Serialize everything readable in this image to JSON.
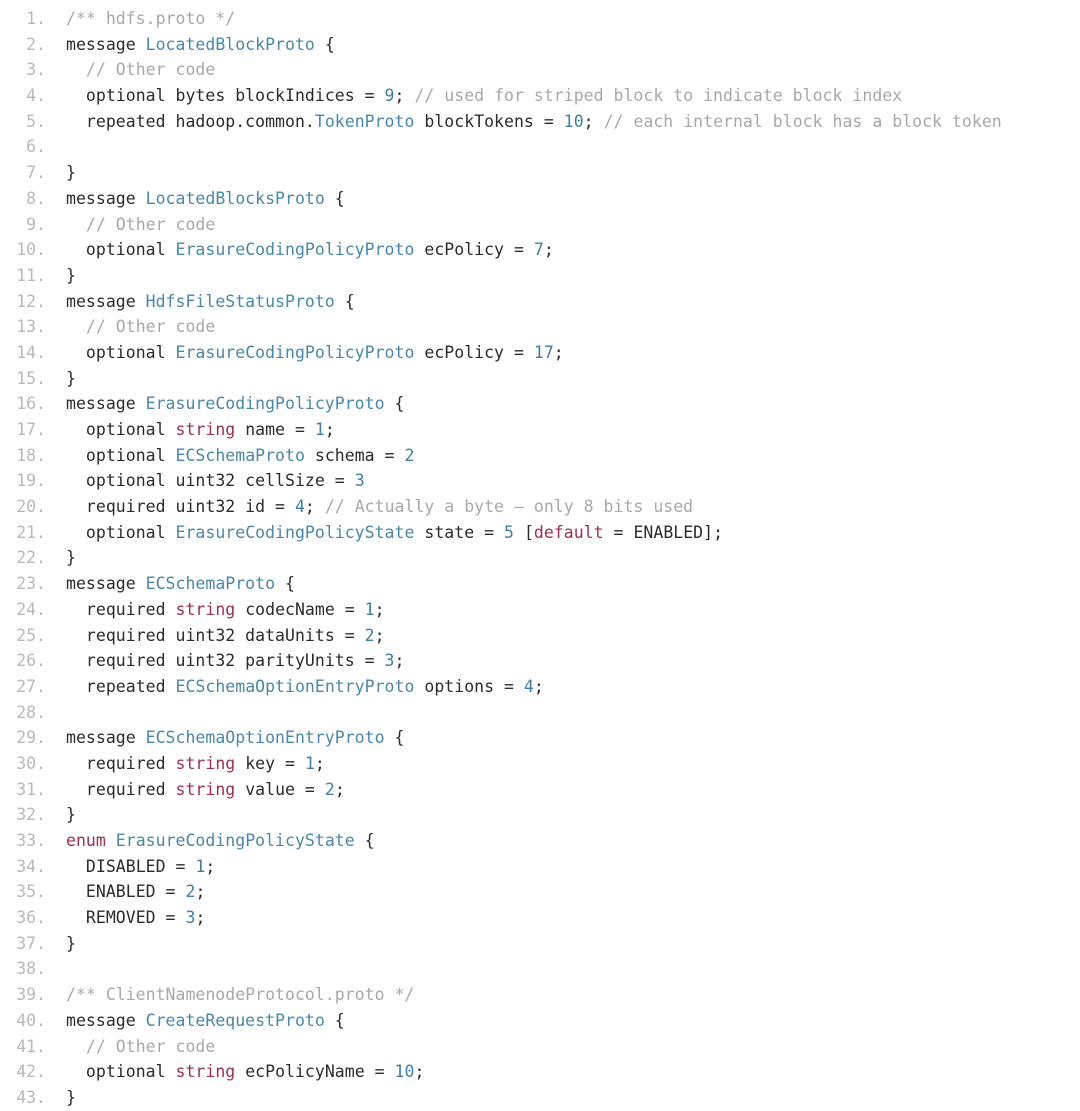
{
  "editor": {
    "title": "hdfs.proto code listing",
    "language": "protobuf",
    "background_color": "#ffffff",
    "colors": {
      "line_number": "#b9b9b9",
      "plain_text": "#2b2b2b",
      "type_name": "#4a87a8",
      "number_literal": "#3f7fa5",
      "keyword": "#9c2f55",
      "comment": "#a8a8a8"
    },
    "first_line_number": 1,
    "last_line_number": 43,
    "total_lines": 43
  },
  "lines": [
    {
      "n": "1.",
      "tokens": [
        {
          "t": "comment",
          "v": "/** hdfs.proto */"
        }
      ],
      "indent": 0
    },
    {
      "n": "2.",
      "tokens": [
        {
          "t": "plain",
          "v": "message "
        },
        {
          "t": "type",
          "v": "LocatedBlockProto"
        },
        {
          "t": "plain",
          "v": " {"
        }
      ],
      "indent": 0
    },
    {
      "n": "3.",
      "tokens": [
        {
          "t": "comment",
          "v": "// Other code"
        }
      ],
      "indent": 1
    },
    {
      "n": "4.",
      "tokens": [
        {
          "t": "plain",
          "v": "optional bytes blockIndices = "
        },
        {
          "t": "number",
          "v": "9"
        },
        {
          "t": "plain",
          "v": "; "
        },
        {
          "t": "comment",
          "v": "// used for striped block to indicate block index"
        }
      ],
      "indent": 1
    },
    {
      "n": "5.",
      "tokens": [
        {
          "t": "plain",
          "v": "repeated hadoop.common."
        },
        {
          "t": "type",
          "v": "TokenProto"
        },
        {
          "t": "plain",
          "v": " blockTokens = "
        },
        {
          "t": "number",
          "v": "10"
        },
        {
          "t": "plain",
          "v": "; "
        },
        {
          "t": "comment",
          "v": "// each internal block has a block token"
        }
      ],
      "indent": 1
    },
    {
      "n": "6.",
      "tokens": [],
      "indent": 0
    },
    {
      "n": "7.",
      "tokens": [
        {
          "t": "plain",
          "v": "}"
        }
      ],
      "indent": 0
    },
    {
      "n": "8.",
      "tokens": [
        {
          "t": "plain",
          "v": "message "
        },
        {
          "t": "type",
          "v": "LocatedBlocksProto"
        },
        {
          "t": "plain",
          "v": " {"
        }
      ],
      "indent": 0
    },
    {
      "n": "9.",
      "tokens": [
        {
          "t": "comment",
          "v": "// Other code"
        }
      ],
      "indent": 1
    },
    {
      "n": "10.",
      "tokens": [
        {
          "t": "plain",
          "v": "optional "
        },
        {
          "t": "type",
          "v": "ErasureCodingPolicyProto"
        },
        {
          "t": "plain",
          "v": " ecPolicy = "
        },
        {
          "t": "number",
          "v": "7"
        },
        {
          "t": "plain",
          "v": ";"
        }
      ],
      "indent": 1
    },
    {
      "n": "11.",
      "tokens": [
        {
          "t": "plain",
          "v": "}"
        }
      ],
      "indent": 0
    },
    {
      "n": "12.",
      "tokens": [
        {
          "t": "plain",
          "v": "message "
        },
        {
          "t": "type",
          "v": "HdfsFileStatusProto"
        },
        {
          "t": "plain",
          "v": " {"
        }
      ],
      "indent": 0
    },
    {
      "n": "13.",
      "tokens": [
        {
          "t": "comment",
          "v": "// Other code"
        }
      ],
      "indent": 1
    },
    {
      "n": "14.",
      "tokens": [
        {
          "t": "plain",
          "v": "optional "
        },
        {
          "t": "type",
          "v": "ErasureCodingPolicyProto"
        },
        {
          "t": "plain",
          "v": " ecPolicy = "
        },
        {
          "t": "number",
          "v": "17"
        },
        {
          "t": "plain",
          "v": ";"
        }
      ],
      "indent": 1
    },
    {
      "n": "15.",
      "tokens": [
        {
          "t": "plain",
          "v": "}"
        }
      ],
      "indent": 0
    },
    {
      "n": "16.",
      "tokens": [
        {
          "t": "plain",
          "v": "message "
        },
        {
          "t": "type",
          "v": "ErasureCodingPolicyProto"
        },
        {
          "t": "plain",
          "v": " {"
        }
      ],
      "indent": 0
    },
    {
      "n": "17.",
      "tokens": [
        {
          "t": "plain",
          "v": "optional "
        },
        {
          "t": "keyword",
          "v": "string"
        },
        {
          "t": "plain",
          "v": " name = "
        },
        {
          "t": "number",
          "v": "1"
        },
        {
          "t": "plain",
          "v": ";"
        }
      ],
      "indent": 1
    },
    {
      "n": "18.",
      "tokens": [
        {
          "t": "plain",
          "v": "optional "
        },
        {
          "t": "type",
          "v": "ECSchemaProto"
        },
        {
          "t": "plain",
          "v": " schema = "
        },
        {
          "t": "number",
          "v": "2"
        }
      ],
      "indent": 1
    },
    {
      "n": "19.",
      "tokens": [
        {
          "t": "plain",
          "v": "optional uint32 cellSize = "
        },
        {
          "t": "number",
          "v": "3"
        }
      ],
      "indent": 1
    },
    {
      "n": "20.",
      "tokens": [
        {
          "t": "plain",
          "v": "required uint32 id = "
        },
        {
          "t": "number",
          "v": "4"
        },
        {
          "t": "plain",
          "v": "; "
        },
        {
          "t": "comment",
          "v": "// Actually a byte – only 8 bits used"
        }
      ],
      "indent": 1
    },
    {
      "n": "21.",
      "tokens": [
        {
          "t": "plain",
          "v": "optional "
        },
        {
          "t": "type",
          "v": "ErasureCodingPolicyState"
        },
        {
          "t": "plain",
          "v": " state = "
        },
        {
          "t": "number",
          "v": "5"
        },
        {
          "t": "plain",
          "v": " ["
        },
        {
          "t": "keyword",
          "v": "default"
        },
        {
          "t": "plain",
          "v": " = ENABLED];"
        }
      ],
      "indent": 1
    },
    {
      "n": "22.",
      "tokens": [
        {
          "t": "plain",
          "v": "}"
        }
      ],
      "indent": 0
    },
    {
      "n": "23.",
      "tokens": [
        {
          "t": "plain",
          "v": "message "
        },
        {
          "t": "type",
          "v": "ECSchemaProto"
        },
        {
          "t": "plain",
          "v": " {"
        }
      ],
      "indent": 0
    },
    {
      "n": "24.",
      "tokens": [
        {
          "t": "plain",
          "v": "required "
        },
        {
          "t": "keyword",
          "v": "string"
        },
        {
          "t": "plain",
          "v": " codecName = "
        },
        {
          "t": "number",
          "v": "1"
        },
        {
          "t": "plain",
          "v": ";"
        }
      ],
      "indent": 1
    },
    {
      "n": "25.",
      "tokens": [
        {
          "t": "plain",
          "v": "required uint32 dataUnits = "
        },
        {
          "t": "number",
          "v": "2"
        },
        {
          "t": "plain",
          "v": ";"
        }
      ],
      "indent": 1
    },
    {
      "n": "26.",
      "tokens": [
        {
          "t": "plain",
          "v": "required uint32 parityUnits = "
        },
        {
          "t": "number",
          "v": "3"
        },
        {
          "t": "plain",
          "v": ";"
        }
      ],
      "indent": 1
    },
    {
      "n": "27.",
      "tokens": [
        {
          "t": "plain",
          "v": "repeated "
        },
        {
          "t": "type",
          "v": "ECSchemaOptionEntryProto"
        },
        {
          "t": "plain",
          "v": " options = "
        },
        {
          "t": "number",
          "v": "4"
        },
        {
          "t": "plain",
          "v": ";"
        }
      ],
      "indent": 1
    },
    {
      "n": "28.",
      "tokens": [],
      "indent": 0
    },
    {
      "n": "29.",
      "tokens": [
        {
          "t": "plain",
          "v": "message "
        },
        {
          "t": "type",
          "v": "ECSchemaOptionEntryProto"
        },
        {
          "t": "plain",
          "v": " {"
        }
      ],
      "indent": 0
    },
    {
      "n": "30.",
      "tokens": [
        {
          "t": "plain",
          "v": "required "
        },
        {
          "t": "keyword",
          "v": "string"
        },
        {
          "t": "plain",
          "v": " key = "
        },
        {
          "t": "number",
          "v": "1"
        },
        {
          "t": "plain",
          "v": ";"
        }
      ],
      "indent": 1
    },
    {
      "n": "31.",
      "tokens": [
        {
          "t": "plain",
          "v": "required "
        },
        {
          "t": "keyword",
          "v": "string"
        },
        {
          "t": "plain",
          "v": " value = "
        },
        {
          "t": "number",
          "v": "2"
        },
        {
          "t": "plain",
          "v": ";"
        }
      ],
      "indent": 1
    },
    {
      "n": "32.",
      "tokens": [
        {
          "t": "plain",
          "v": "}"
        }
      ],
      "indent": 0
    },
    {
      "n": "33.",
      "tokens": [
        {
          "t": "keyword",
          "v": "enum"
        },
        {
          "t": "plain",
          "v": " "
        },
        {
          "t": "type",
          "v": "ErasureCodingPolicyState"
        },
        {
          "t": "plain",
          "v": " {"
        }
      ],
      "indent": 0
    },
    {
      "n": "34.",
      "tokens": [
        {
          "t": "plain",
          "v": "DISABLED = "
        },
        {
          "t": "number",
          "v": "1"
        },
        {
          "t": "plain",
          "v": ";"
        }
      ],
      "indent": 1
    },
    {
      "n": "35.",
      "tokens": [
        {
          "t": "plain",
          "v": "ENABLED = "
        },
        {
          "t": "number",
          "v": "2"
        },
        {
          "t": "plain",
          "v": ";"
        }
      ],
      "indent": 1
    },
    {
      "n": "36.",
      "tokens": [
        {
          "t": "plain",
          "v": "REMOVED = "
        },
        {
          "t": "number",
          "v": "3"
        },
        {
          "t": "plain",
          "v": ";"
        }
      ],
      "indent": 1
    },
    {
      "n": "37.",
      "tokens": [
        {
          "t": "plain",
          "v": "}"
        }
      ],
      "indent": 0
    },
    {
      "n": "38.",
      "tokens": [],
      "indent": 0
    },
    {
      "n": "39.",
      "tokens": [
        {
          "t": "comment",
          "v": "/** ClientNamenodeProtocol.proto */"
        }
      ],
      "indent": 0
    },
    {
      "n": "40.",
      "tokens": [
        {
          "t": "plain",
          "v": "message "
        },
        {
          "t": "type",
          "v": "CreateRequestProto"
        },
        {
          "t": "plain",
          "v": " {"
        }
      ],
      "indent": 0
    },
    {
      "n": "41.",
      "tokens": [
        {
          "t": "comment",
          "v": "// Other code"
        }
      ],
      "indent": 1
    },
    {
      "n": "42.",
      "tokens": [
        {
          "t": "plain",
          "v": "optional "
        },
        {
          "t": "keyword",
          "v": "string"
        },
        {
          "t": "plain",
          "v": " ecPolicyName = "
        },
        {
          "t": "number",
          "v": "10"
        },
        {
          "t": "plain",
          "v": ";"
        }
      ],
      "indent": 1
    },
    {
      "n": "43.",
      "tokens": [
        {
          "t": "plain",
          "v": "}"
        }
      ],
      "indent": 0
    }
  ]
}
